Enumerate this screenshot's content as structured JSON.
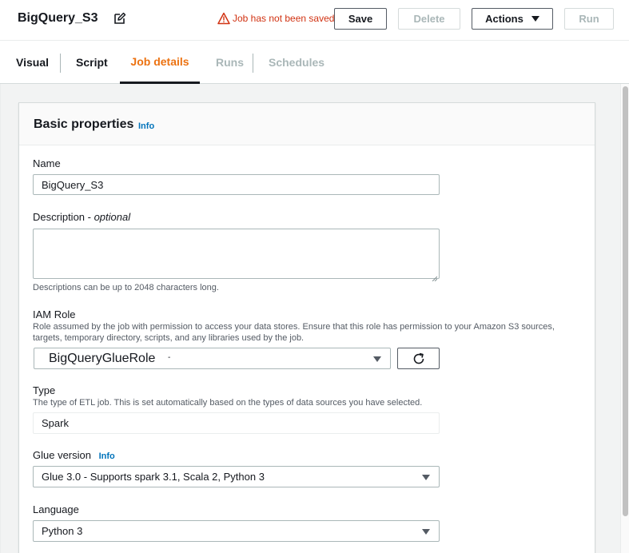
{
  "header": {
    "job_title": "BigQuery_S3",
    "warning": "Job has not been saved",
    "save_label": "Save",
    "delete_label": "Delete",
    "actions_label": "Actions",
    "run_label": "Run"
  },
  "tabs": [
    {
      "label": "Visual",
      "state": "normal"
    },
    {
      "label": "Script",
      "state": "normal"
    },
    {
      "label": "Job details",
      "state": "active"
    },
    {
      "label": "Runs",
      "state": "disabled"
    },
    {
      "label": "Schedules",
      "state": "disabled"
    }
  ],
  "panel": {
    "title": "Basic properties",
    "info": "Info"
  },
  "fields": {
    "name": {
      "label": "Name",
      "value": "BigQuery_S3"
    },
    "description": {
      "label": "Description - ",
      "label_optional": "optional",
      "value": "",
      "hint": "Descriptions can be up to 2048 characters long."
    },
    "iam_role": {
      "label": "IAM Role",
      "hint": "Role assumed by the job with permission to access your data stores. Ensure that this role has permission to your Amazon S3 sources, targets, temporary directory, scripts, and any libraries used by the job.",
      "value": "BigQueryGlueRole",
      "suffix": "-"
    },
    "type": {
      "label": "Type",
      "hint": "The type of ETL job. This is set automatically based on the types of data sources you have selected.",
      "value": "Spark"
    },
    "glue_version": {
      "label": "Glue version",
      "info": "Info",
      "value": "Glue 3.0 - Supports spark 3.1, Scala 2, Python 3"
    },
    "language": {
      "label": "Language",
      "value": "Python 3"
    }
  },
  "colors": {
    "accent": "#ec7211",
    "link": "#0073bb",
    "warning": "#d13212"
  }
}
